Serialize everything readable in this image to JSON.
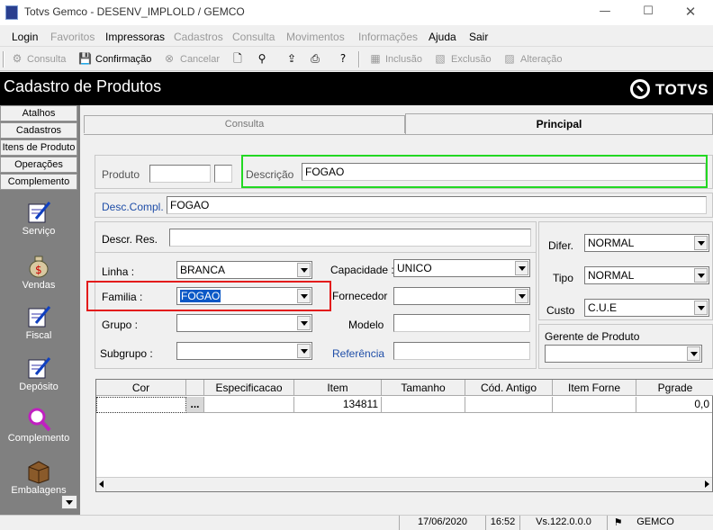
{
  "window": {
    "title": "Totvs Gemco - DESENV_IMPLOLD / GEMCO"
  },
  "menu": [
    "Login",
    "Favoritos",
    "Impressoras",
    "Cadastros",
    "Consulta",
    "Movimentos",
    "Informações",
    "Ajuda",
    "Sair"
  ],
  "toolbar": {
    "consulta": "Consulta",
    "confirmacao": "Confirmação",
    "cancelar": "Cancelar",
    "inclusao": "Inclusão",
    "exclusao": "Exclusão",
    "alteracao": "Alteração"
  },
  "header": {
    "title": "Cadastro de Produtos",
    "brand": "TOTVS"
  },
  "sidebar": {
    "tabs": [
      "Atalhos",
      "Cadastros",
      "Itens de Produto",
      "Operações",
      "Complemento"
    ],
    "buttons": [
      "Serviço",
      "Vendas",
      "Fiscal",
      "Depósito",
      "Complemento",
      "Embalagens"
    ]
  },
  "tabs": {
    "consulta": "Consulta",
    "principal": "Principal"
  },
  "form": {
    "produto_label": "Produto",
    "descricao_label": "Descrição",
    "descricao_value": "FOGAO",
    "desc_compl_label": "Desc.Compl.",
    "desc_compl_value": "FOGAO",
    "descr_res_label": "Descr. Res.",
    "linha_label": "Linha :",
    "linha_value": "BRANCA",
    "familia_label": "Familia :",
    "familia_value": "FOGAO",
    "grupo_label": "Grupo :",
    "subgrupo_label": "Subgrupo :",
    "capacidade_label": "Capacidade :",
    "capacidade_value": "UNICO",
    "fornecedor_label": "Fornecedor",
    "modelo_label": "Modelo",
    "referencia_label": "Referência",
    "difer_label": "Difer.",
    "difer_value": "NORMAL",
    "tipo_label": "Tipo",
    "tipo_value": "NORMAL",
    "custo_label": "Custo",
    "custo_value": "C.U.E",
    "gerente_label": "Gerente de Produto"
  },
  "grid": {
    "columns": [
      "Cor",
      "",
      "Especificacao",
      "Item",
      "Tamanho",
      "Cód. Antigo",
      "Item Forne",
      "Pgrade"
    ],
    "row": [
      "",
      "...",
      "",
      "134811",
      "",
      "",
      "",
      "0,0"
    ]
  },
  "status": {
    "date": "17/06/2020",
    "time": "16:52",
    "version": "Vs.122.0.0.0",
    "company": "GEMCO"
  }
}
